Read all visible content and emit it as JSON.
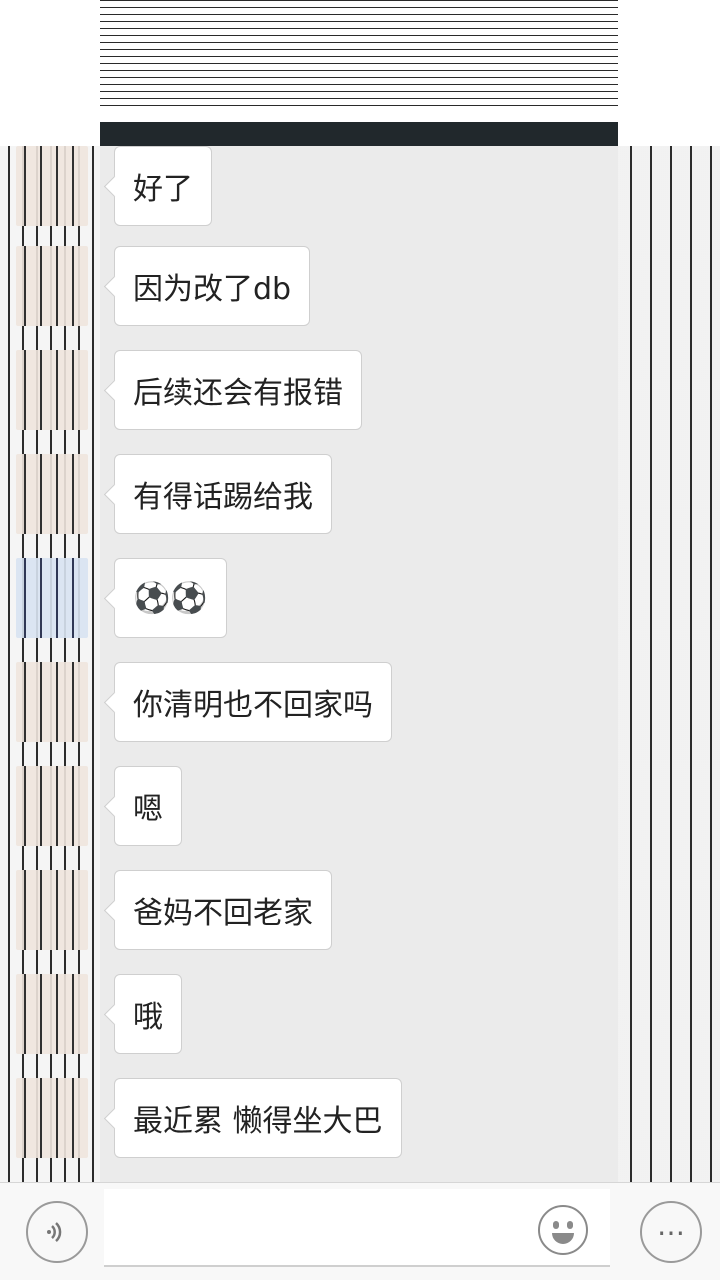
{
  "header": {
    "title": ""
  },
  "messages": [
    {
      "text": "好了",
      "avatar_style": "default"
    },
    {
      "text": "因为改了db",
      "avatar_style": "default"
    },
    {
      "text": "后续还会有报错",
      "avatar_style": "default"
    },
    {
      "text": "有得话踢给我",
      "avatar_style": "default"
    },
    {
      "text": "⚽⚽",
      "avatar_style": "blue"
    },
    {
      "text": "你清明也不回家吗",
      "avatar_style": "default"
    },
    {
      "text": "嗯",
      "avatar_style": "default"
    },
    {
      "text": "爸妈不回老家",
      "avatar_style": "default"
    },
    {
      "text": "哦",
      "avatar_style": "default"
    },
    {
      "text": "最近累 懒得坐大巴",
      "avatar_style": "default"
    }
  ],
  "input_bar": {
    "voice_icon": "voice-icon",
    "emoji_icon": "emoji-icon",
    "more_icon": "more-icon",
    "more_glyph": "⋯",
    "input_value": ""
  },
  "colors": {
    "chat_background": "#ebebeb",
    "bubble": "#ffffff",
    "header_bar": "#21282c"
  }
}
